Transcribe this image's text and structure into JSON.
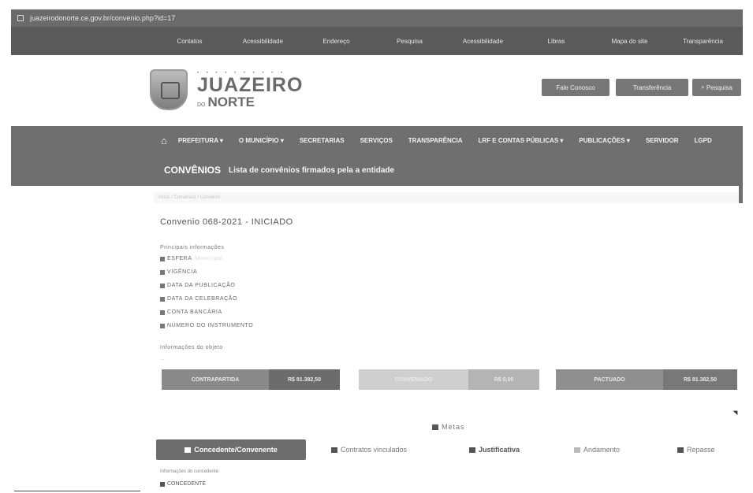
{
  "browser": {
    "url": "juazeirodonorte.ce.gov.br/convenio.php?id=17"
  },
  "top_nav": [
    {
      "label": "Contatos"
    },
    {
      "label": "Acessibilidade"
    },
    {
      "label": "Endereço"
    },
    {
      "label": "Pesquisa"
    },
    {
      "label": "Acessibilidade"
    },
    {
      "label": "Libras"
    },
    {
      "label": "Mapa do site"
    },
    {
      "label": "Transparência"
    }
  ],
  "logo": {
    "line1": "JUAZEIRO",
    "prefix": "DO",
    "line2": "NORTE"
  },
  "header_buttons": [
    {
      "label": "Fale Conosco"
    },
    {
      "label": "Transferência"
    },
    {
      "label": "Pesquisa"
    }
  ],
  "main_nav": [
    {
      "label": "PREFEITURA ▾"
    },
    {
      "label": "O MUNICÍPIO ▾"
    },
    {
      "label": "SECRETARIAS"
    },
    {
      "label": "SERVIÇOS"
    },
    {
      "label": "TRANSPARÊNCIA"
    },
    {
      "label": "LRF E CONTAS PÚBLICAS ▾"
    },
    {
      "label": "PUBLICAÇÕES ▾"
    },
    {
      "label": "SERVIDOR"
    },
    {
      "label": "LGPD"
    }
  ],
  "page_title": {
    "badge": "CONVÊNIOS",
    "subtitle": "Lista de convênios firmados pela a entidade"
  },
  "breadcrumb": "Início  /  Convênios  /  Convênio",
  "convenio": {
    "title": "Convenio 068-2021 - INICIADO",
    "main_info_label": "Principais informações",
    "fields": [
      {
        "label": "ESFERA",
        "value": "Municipal"
      },
      {
        "label": "VIGÊNCIA",
        "value": ""
      },
      {
        "label": "DATA DA PUBLICAÇÃO",
        "value": ""
      },
      {
        "label": "DATA DA CELEBRAÇÃO",
        "value": ""
      },
      {
        "label": "CONTA BANCÁRIA",
        "value": ""
      },
      {
        "label": "NÚMERO DO INSTRUMENTO",
        "value": ""
      }
    ],
    "object_label": "Informações do objeto",
    "object_text": "—"
  },
  "value_boxes": [
    {
      "label": "CONTRAPARTIDA",
      "value": "R$ 81.382,50"
    },
    {
      "label": "CONVENIADO",
      "value": "R$ 0,00"
    },
    {
      "label": "PACTUADO",
      "value": "R$ 81.382,50"
    }
  ],
  "metas_label": "Metas",
  "tabs": [
    {
      "label": "Concedente/Convenente",
      "active": true
    },
    {
      "label": "Contratos vinculados"
    },
    {
      "label": "Justificativa"
    },
    {
      "label": "Andamento"
    },
    {
      "label": "Repasse"
    }
  ],
  "concedente": {
    "info_label": "Informações do concedente",
    "label": "CONCEDENTE",
    "value": ""
  }
}
